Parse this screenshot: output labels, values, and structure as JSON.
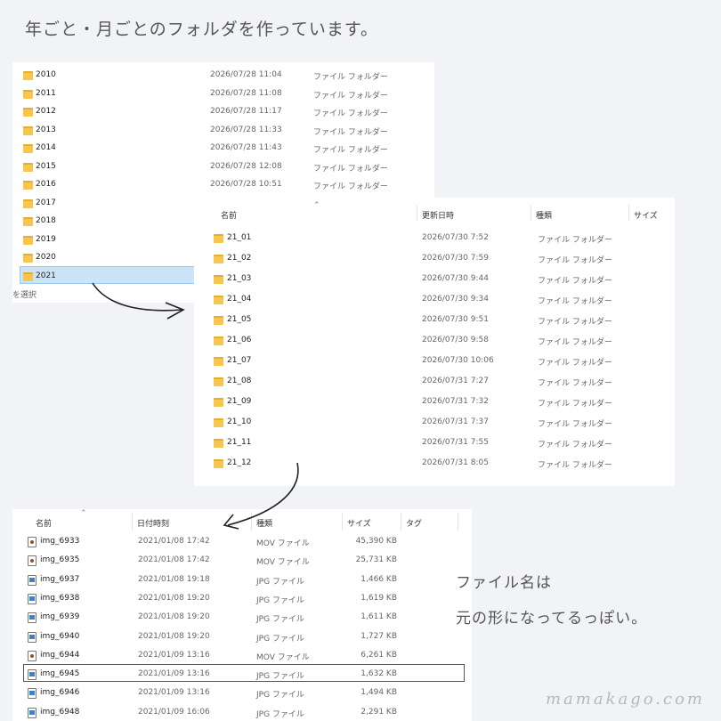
{
  "heading": "年ごと・月ごとのフォルダを作っています。",
  "year_panel": {
    "rows": [
      {
        "name": "2010",
        "date": "2026/07/28 11:04",
        "type": "ファイル フォルダー"
      },
      {
        "name": "2011",
        "date": "2026/07/28 11:08",
        "type": "ファイル フォルダー"
      },
      {
        "name": "2012",
        "date": "2026/07/28 11:17",
        "type": "ファイル フォルダー"
      },
      {
        "name": "2013",
        "date": "2026/07/28 11:33",
        "type": "ファイル フォルダー"
      },
      {
        "name": "2014",
        "date": "2026/07/28 11:43",
        "type": "ファイル フォルダー"
      },
      {
        "name": "2015",
        "date": "2026/07/28 12:08",
        "type": "ファイル フォルダー"
      },
      {
        "name": "2016",
        "date": "2026/07/28 10:51",
        "type": "ファイル フォルダー"
      },
      {
        "name": "2017",
        "date": "",
        "type": ""
      },
      {
        "name": "2018",
        "date": "",
        "type": ""
      },
      {
        "name": "2019",
        "date": "",
        "type": ""
      },
      {
        "name": "2020",
        "date": "",
        "type": ""
      },
      {
        "name": "2021",
        "date": "",
        "type": ""
      }
    ],
    "status": "を選択"
  },
  "month_panel": {
    "headers": {
      "name": "名前",
      "date": "更新日時",
      "type": "種類",
      "size": "サイズ"
    },
    "rows": [
      {
        "name": "21_01",
        "date": "2026/07/30 7:52",
        "type": "ファイル フォルダー"
      },
      {
        "name": "21_02",
        "date": "2026/07/30 7:59",
        "type": "ファイル フォルダー"
      },
      {
        "name": "21_03",
        "date": "2026/07/30 9:44",
        "type": "ファイル フォルダー"
      },
      {
        "name": "21_04",
        "date": "2026/07/30 9:34",
        "type": "ファイル フォルダー"
      },
      {
        "name": "21_05",
        "date": "2026/07/30 9:51",
        "type": "ファイル フォルダー"
      },
      {
        "name": "21_06",
        "date": "2026/07/30 9:58",
        "type": "ファイル フォルダー"
      },
      {
        "name": "21_07",
        "date": "2026/07/30 10:06",
        "type": "ファイル フォルダー"
      },
      {
        "name": "21_08",
        "date": "2026/07/31 7:27",
        "type": "ファイル フォルダー"
      },
      {
        "name": "21_09",
        "date": "2026/07/31 7:32",
        "type": "ファイル フォルダー"
      },
      {
        "name": "21_10",
        "date": "2026/07/31 7:37",
        "type": "ファイル フォルダー"
      },
      {
        "name": "21_11",
        "date": "2026/07/31 7:55",
        "type": "ファイル フォルダー"
      },
      {
        "name": "21_12",
        "date": "2026/07/31 8:05",
        "type": "ファイル フォルダー"
      }
    ]
  },
  "file_panel": {
    "headers": {
      "name": "名前",
      "date": "日付時刻",
      "type": "種類",
      "size": "サイズ",
      "tag": "タグ"
    },
    "rows": [
      {
        "icon": "movie-file-icon",
        "name": "img_6933",
        "date": "2021/01/08 17:42",
        "type": "MOV ファイル",
        "size": "45,390 KB"
      },
      {
        "icon": "movie-file-icon",
        "name": "img_6935",
        "date": "2021/01/08 17:42",
        "type": "MOV ファイル",
        "size": "25,731 KB"
      },
      {
        "icon": "image-file-icon",
        "name": "img_6937",
        "date": "2021/01/08 19:18",
        "type": "JPG ファイル",
        "size": "1,466 KB"
      },
      {
        "icon": "image-file-icon",
        "name": "img_6938",
        "date": "2021/01/08 19:20",
        "type": "JPG ファイル",
        "size": "1,619 KB"
      },
      {
        "icon": "image-file-icon",
        "name": "img_6939",
        "date": "2021/01/08 19:20",
        "type": "JPG ファイル",
        "size": "1,611 KB"
      },
      {
        "icon": "image-file-icon",
        "name": "img_6940",
        "date": "2021/01/08 19:20",
        "type": "JPG ファイル",
        "size": "1,727 KB"
      },
      {
        "icon": "movie-file-icon",
        "name": "img_6944",
        "date": "2021/01/09 13:16",
        "type": "MOV ファイル",
        "size": "6,261 KB"
      },
      {
        "icon": "image-file-icon",
        "name": "img_6945",
        "date": "2021/01/09 13:16",
        "type": "JPG ファイル",
        "size": "1,632 KB"
      },
      {
        "icon": "image-file-icon",
        "name": "img_6946",
        "date": "2021/01/09 13:16",
        "type": "JPG ファイル",
        "size": "1,494 KB"
      },
      {
        "icon": "image-file-icon",
        "name": "img_6948",
        "date": "2021/01/09 16:06",
        "type": "JPG ファイル",
        "size": "2,291 KB"
      }
    ]
  },
  "side_note": {
    "line1": "ファイル名は",
    "line2": "元の形になってるっぽい。"
  },
  "watermark": "mamakago.com"
}
